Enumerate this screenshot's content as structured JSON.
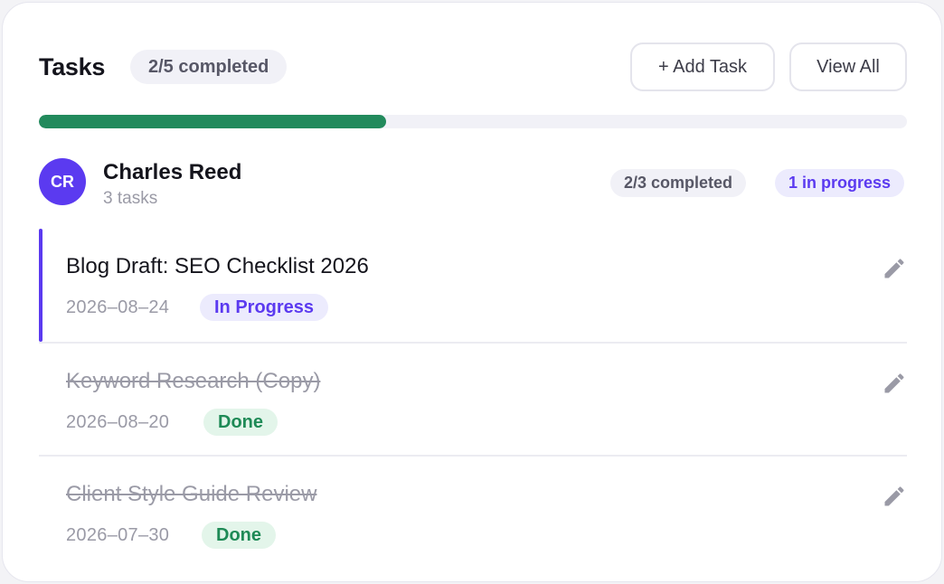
{
  "header": {
    "title": "Tasks",
    "count": "2/5 completed",
    "add_label": "+ Add Task",
    "view_label": "View All"
  },
  "progress": {
    "fraction": 0.4,
    "color": "#228a5c"
  },
  "user": {
    "initials": "CR",
    "name": "Charles Reed",
    "subtitle": "3 tasks",
    "completed": "2/3 completed",
    "in_progress": "1 in progress"
  },
  "tasks": [
    {
      "title": "Blog Draft: SEO Checklist 2026",
      "date": "2026–08–24",
      "status": "In Progress",
      "done": false,
      "icon": "pencil-icon"
    },
    {
      "title": "Keyword Research (Copy)",
      "date": "2026–08–20",
      "status": "Done",
      "done": true,
      "icon": "pencil-icon"
    },
    {
      "title": "Client Style Guide Review",
      "date": "2026–07–30",
      "status": "Done",
      "done": true,
      "icon": "pencil-icon"
    }
  ],
  "colors": {
    "accent": "#5b3af0",
    "success": "#228a5c",
    "done_bg": "#e3f5ea",
    "progress_bg": "#ecebfd"
  }
}
